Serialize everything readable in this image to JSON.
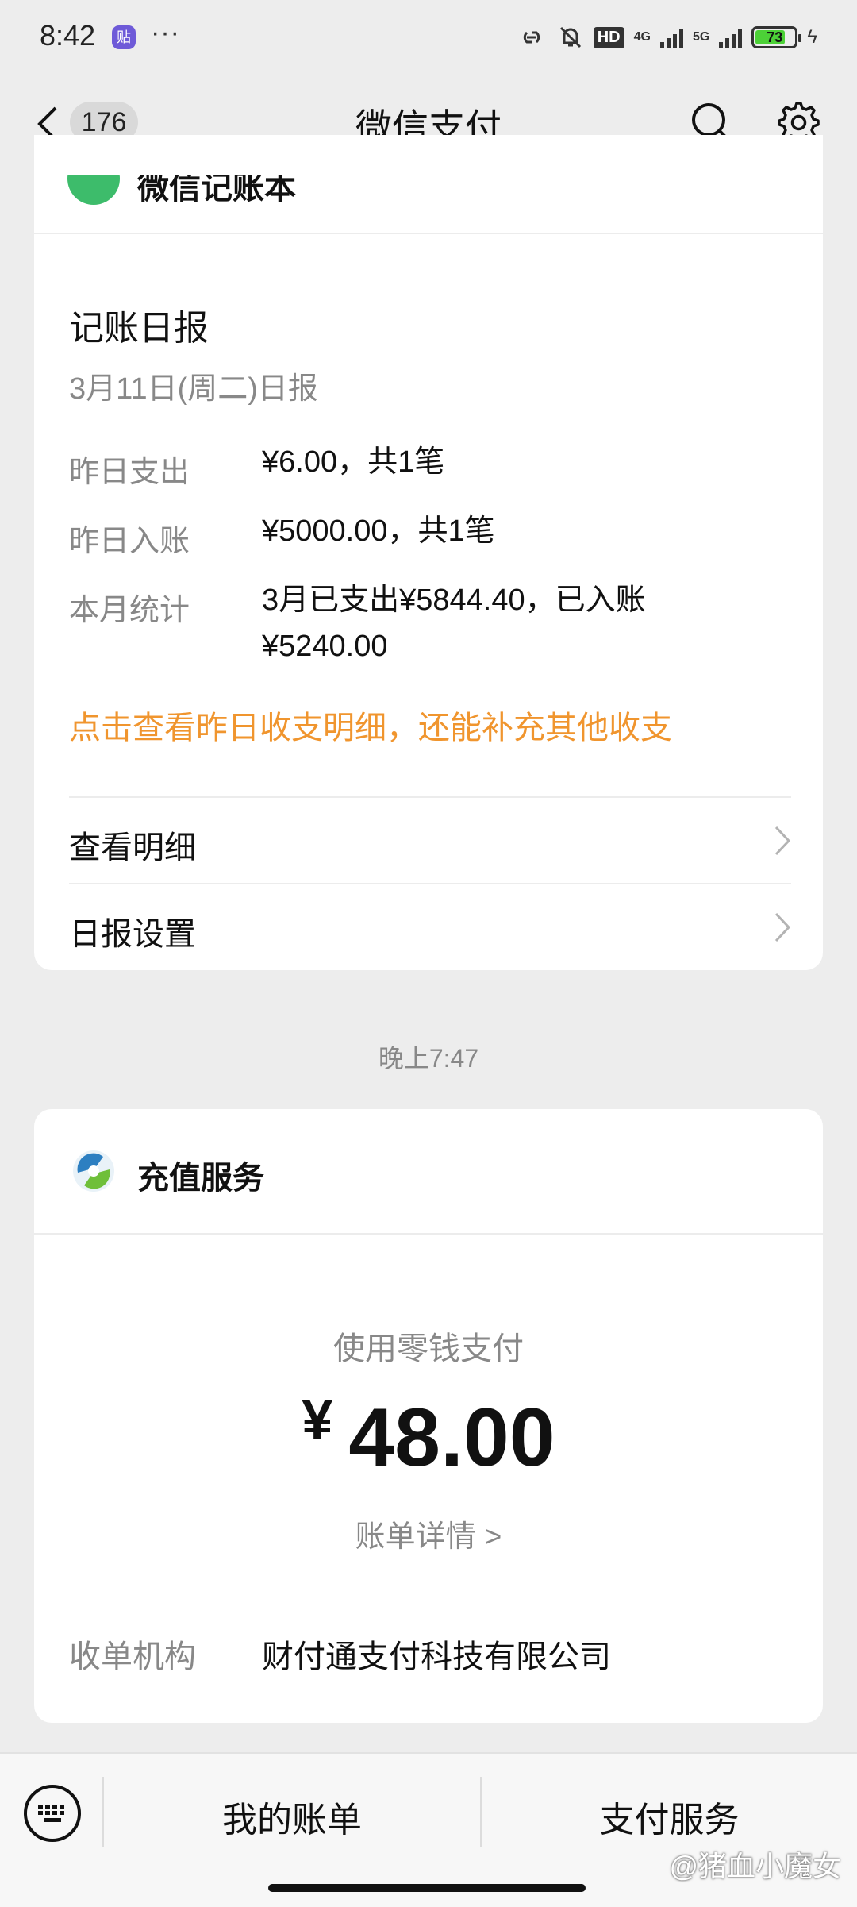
{
  "status_bar": {
    "time": "8:42",
    "app_badge": "贴",
    "more": "···",
    "hd": "HD",
    "net1": "4G",
    "net2": "5G",
    "battery": "73"
  },
  "nav": {
    "unread_count": "176",
    "title": "微信支付"
  },
  "ledger_card": {
    "header_title": "微信记账本",
    "report_title": "记账日报",
    "report_date": "3月11日(周二)日报",
    "rows": [
      {
        "label": "昨日支出",
        "value": "¥6.00，共1笔"
      },
      {
        "label": "昨日入账",
        "value": "¥5000.00，共1笔"
      },
      {
        "label": "本月统计",
        "value_line1": "3月已支出¥5844.40，已入账",
        "value_line2": "¥5240.00"
      }
    ],
    "link": "点击查看昨日收支明细，还能补充其他收支",
    "menu": [
      {
        "label": "查看明细"
      },
      {
        "label": "日报设置"
      }
    ]
  },
  "timestamp": "晚上7:47",
  "service_card": {
    "title": "充值服务",
    "pay_method": "使用零钱支付",
    "currency": "¥",
    "amount": "48.00",
    "bill_detail": "账单详情 >",
    "merchant_label": "收单机构",
    "merchant_value": "财付通支付科技有限公司"
  },
  "bottom_bar": {
    "my_bills": "我的账单",
    "pay_services": "支付服务"
  },
  "watermark": "@猪血小魔女"
}
